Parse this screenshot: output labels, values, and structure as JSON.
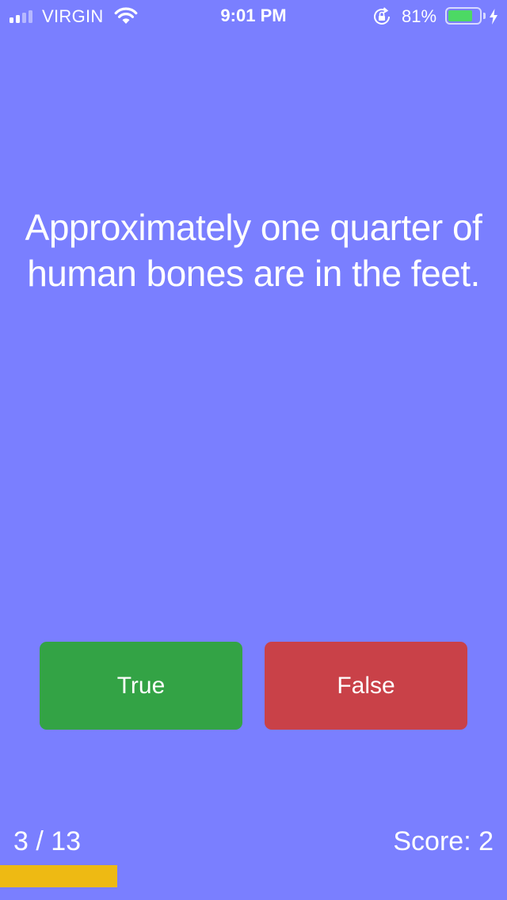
{
  "status_bar": {
    "carrier": "VIRGIN",
    "time": "9:01 PM",
    "battery_percent": "81%",
    "battery_level": 0.81,
    "signal_bars_total": 5,
    "signal_bars_active": 2,
    "icons": [
      "signal-icon",
      "wifi-icon",
      "rotation-lock-icon",
      "battery-icon",
      "charging-bolt-icon"
    ]
  },
  "quiz": {
    "question": "Approximately one quarter of human bones are in the feet.",
    "true_label": "True",
    "false_label": "False",
    "progress_text": "3 / 13",
    "score_text": "Score: 2",
    "progress_fraction": 0.2308
  },
  "colors": {
    "background": "#7a7fff",
    "true_button": "#33a345",
    "false_button": "#c94148",
    "progress_bar": "#eeba13"
  }
}
